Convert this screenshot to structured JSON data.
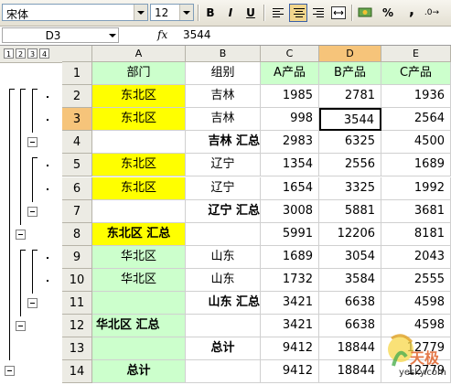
{
  "toolbar": {
    "font_name": "宋体",
    "font_size": "12",
    "bold_label": "B",
    "italic_label": "I",
    "underline_label": "U",
    "percent_label": "%",
    "comma_label": ","
  },
  "formula_bar": {
    "name_box": "D3",
    "fx_label": "fx",
    "value": "3544"
  },
  "outline_levels": [
    "1",
    "2",
    "3",
    "4"
  ],
  "columns": [
    "A",
    "B",
    "C",
    "D",
    "E"
  ],
  "selected_column": "D",
  "selected_row": "3",
  "rows": [
    {
      "num": "1",
      "cells": [
        "部门",
        "组别",
        "A产品",
        "B产品",
        "C产品"
      ]
    },
    {
      "num": "2",
      "cells": [
        "东北区",
        "吉林",
        "1985",
        "2781",
        "1936"
      ]
    },
    {
      "num": "3",
      "cells": [
        "东北区",
        "吉林",
        "998",
        "3544",
        "2564"
      ]
    },
    {
      "num": "4",
      "cells": [
        "",
        "吉林 汇总",
        "2983",
        "6325",
        "4500"
      ]
    },
    {
      "num": "5",
      "cells": [
        "东北区",
        "辽宁",
        "1354",
        "2556",
        "1689"
      ]
    },
    {
      "num": "6",
      "cells": [
        "东北区",
        "辽宁",
        "1654",
        "3325",
        "1992"
      ]
    },
    {
      "num": "7",
      "cells": [
        "",
        "辽宁 汇总",
        "3008",
        "5881",
        "3681"
      ]
    },
    {
      "num": "8",
      "cells": [
        "东北区 汇总",
        "",
        "5991",
        "12206",
        "8181"
      ]
    },
    {
      "num": "9",
      "cells": [
        "华北区",
        "山东",
        "1689",
        "3054",
        "2043"
      ]
    },
    {
      "num": "10",
      "cells": [
        "华北区",
        "山东",
        "1732",
        "3584",
        "2555"
      ]
    },
    {
      "num": "11",
      "cells": [
        "",
        "山东 汇总",
        "3421",
        "6638",
        "4598"
      ]
    },
    {
      "num": "12",
      "cells": [
        "华北区 汇总",
        "",
        "3421",
        "6638",
        "4598"
      ]
    },
    {
      "num": "13",
      "cells": [
        "",
        "总计",
        "9412",
        "18844",
        "12779"
      ]
    },
    {
      "num": "14",
      "cells": [
        "总计",
        "",
        "9412",
        "18844",
        "12779"
      ]
    }
  ],
  "watermark": {
    "brand": "天极",
    "site": "yesky.com"
  }
}
